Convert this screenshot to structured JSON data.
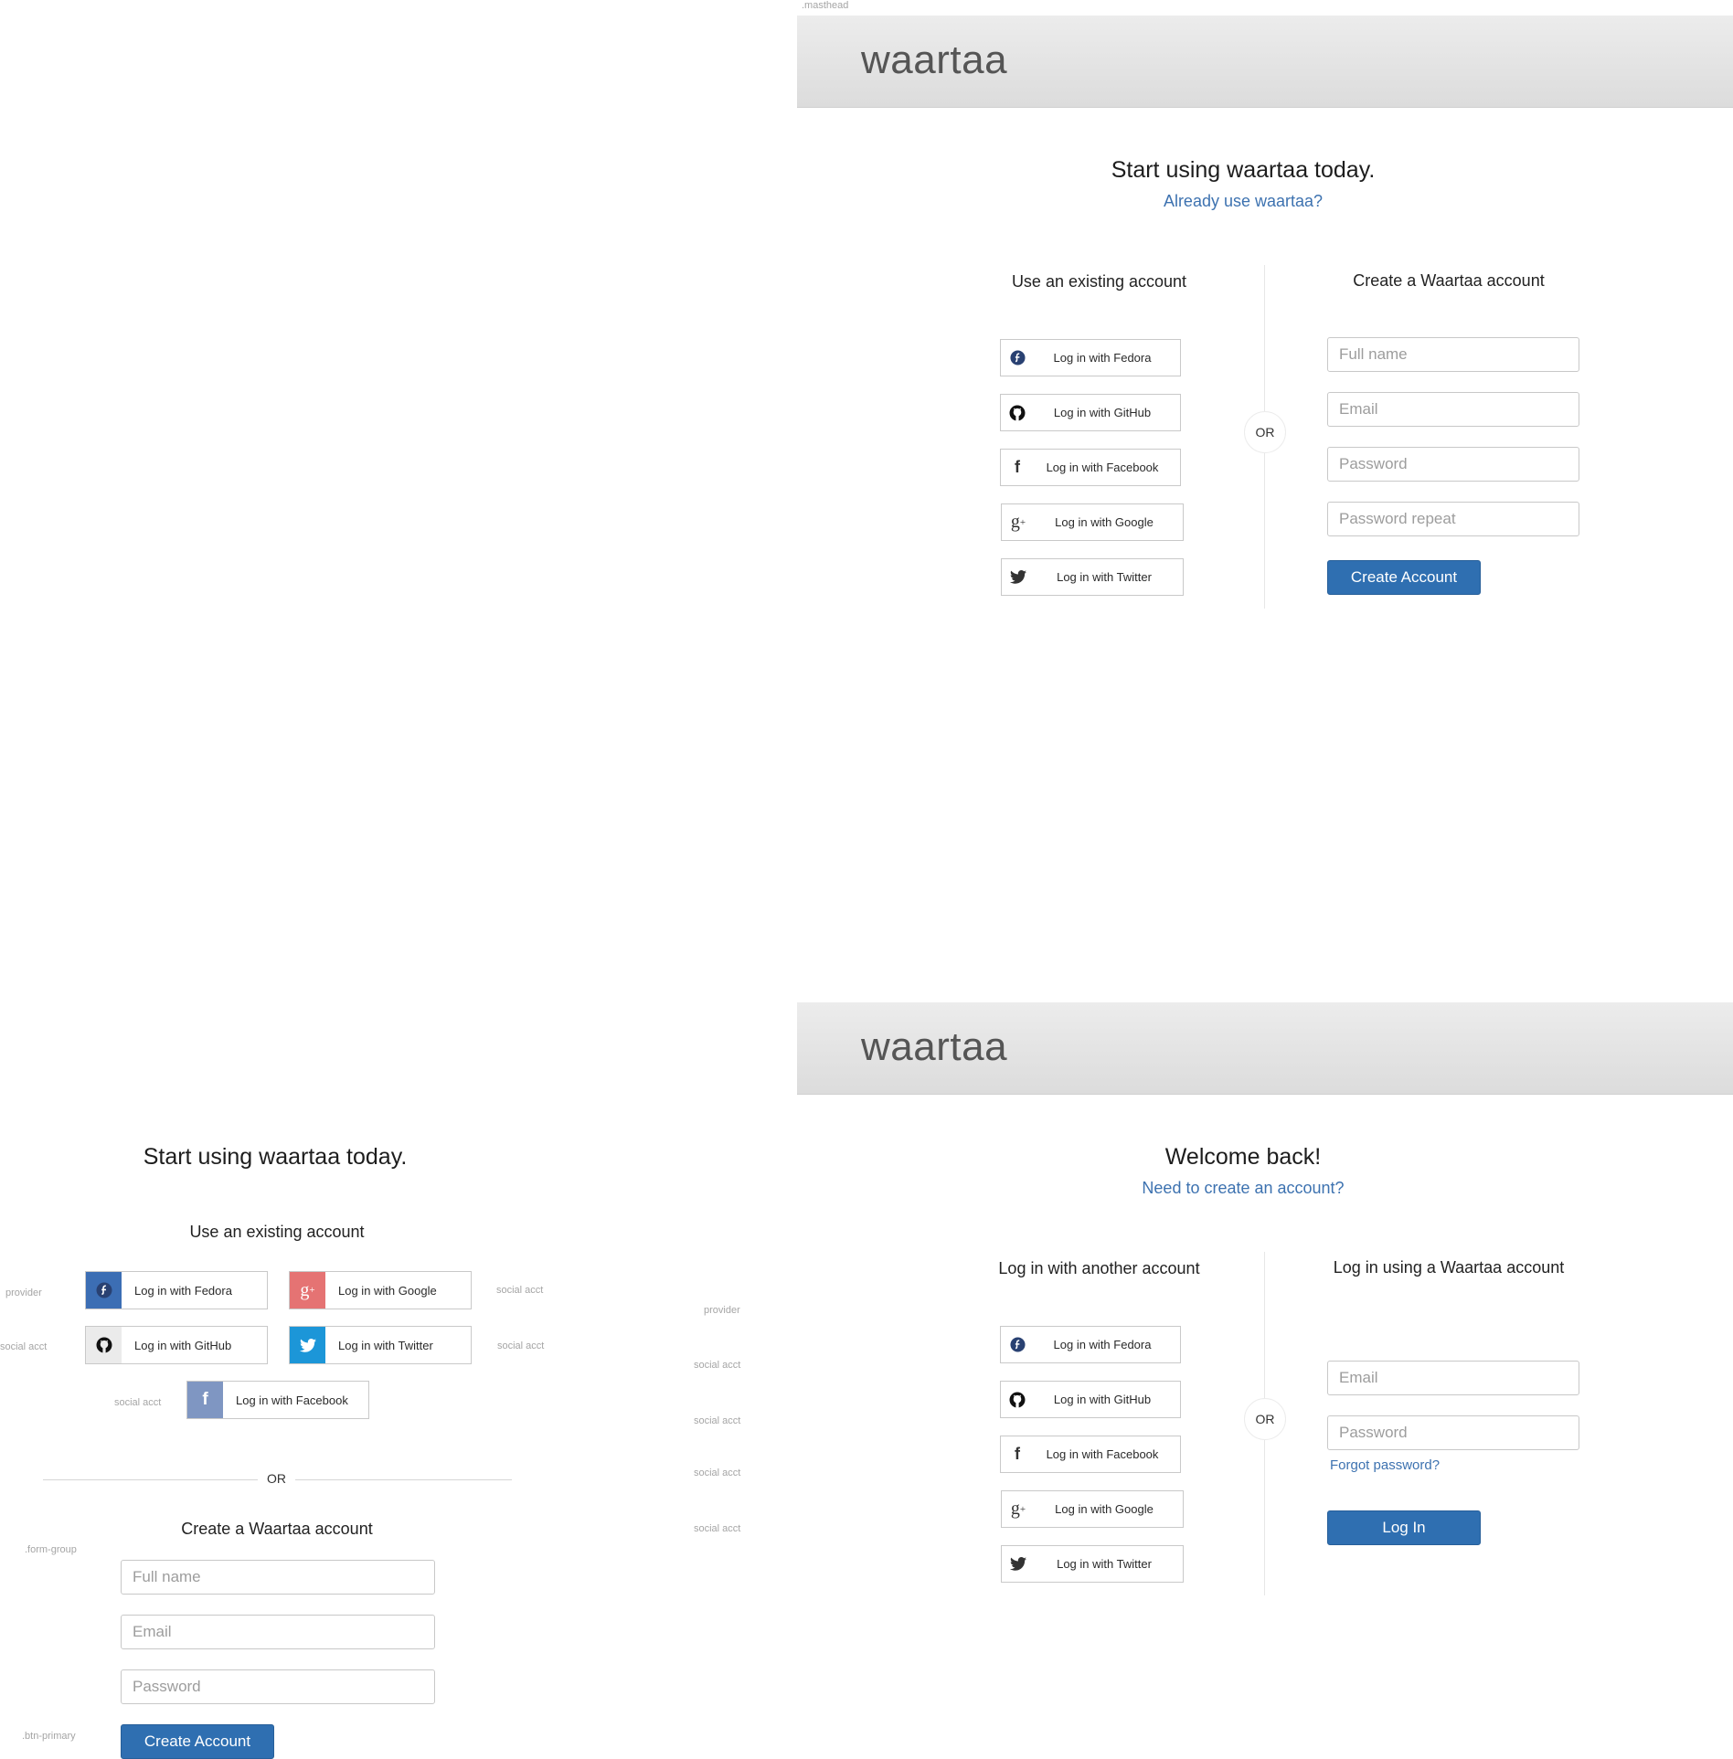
{
  "brand": "waartaa",
  "annotations": {
    "masthead": ".masthead",
    "provider": "provider",
    "social_acct": "social acct",
    "form_group": ".form-group",
    "btn_primary": ".btn-primary"
  },
  "social": {
    "fedora": "Log in with Fedora",
    "github": "Log in with GitHub",
    "facebook": "Log in with Facebook",
    "google": "Log in with Google",
    "twitter": "Log in with Twitter"
  },
  "or_label": "OR",
  "signup": {
    "title": "Start using waartaa today.",
    "login_link": "Already use waartaa?",
    "existing_heading": "Use an existing account",
    "create_heading": "Create a Waartaa account",
    "fields": {
      "full_name": "Full name",
      "email": "Email",
      "password": "Password",
      "password_repeat": "Password repeat"
    },
    "submit": "Create Account"
  },
  "login": {
    "title": "Welcome back!",
    "signup_link": "Need to create an account?",
    "other_heading": "Log in with another account",
    "local_heading": "Log in using a Waartaa account",
    "fields": {
      "email": "Email",
      "password": "Password"
    },
    "forgot": "Forgot password?",
    "submit": "Log In"
  },
  "colors": {
    "fedora_tile": "#3c6eb4",
    "github_tile": "#ebebeb",
    "google_tile": "#e57373",
    "twitter_tile": "#1c96d8",
    "facebook_tile": "#7f96c2",
    "primary": "#2f6fb1",
    "link": "#3d72b0"
  }
}
